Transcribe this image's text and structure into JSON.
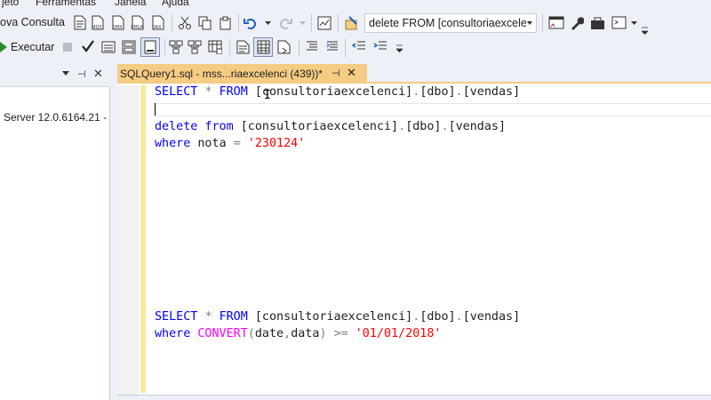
{
  "menu": {
    "items": [
      "jeto",
      "Ferramentas",
      "Janela",
      "Ajuda"
    ]
  },
  "toolbar": {
    "new_query_label": "ova Consulta",
    "execute_label": "Executar",
    "query_combo_value": "delete FROM [consultoriaexcele"
  },
  "explorer": {
    "server_node": "Server 12.0.6164.21 -"
  },
  "tab": {
    "title": "SQLQuery1.sql - mss...riaexcelenci (439))*",
    "pin_glyph": "⊣",
    "close_glyph": "✕"
  },
  "editor": {
    "lines": [
      {
        "tokens": [
          [
            "kw",
            "SELECT"
          ],
          [
            "plain",
            " "
          ],
          [
            "op",
            "*"
          ],
          [
            "plain",
            " "
          ],
          [
            "kw",
            "FROM"
          ],
          [
            "plain",
            " [consultoriaexcelenci]"
          ],
          [
            "op",
            "."
          ],
          [
            "plain",
            "[dbo]"
          ],
          [
            "op",
            "."
          ],
          [
            "plain",
            "[vendas]"
          ]
        ]
      },
      {
        "tokens": []
      },
      {
        "tokens": [
          [
            "kw",
            "delete"
          ],
          [
            "plain",
            " "
          ],
          [
            "kw",
            "from"
          ],
          [
            "plain",
            " [consultoriaexcelenci]"
          ],
          [
            "op",
            "."
          ],
          [
            "plain",
            "[dbo]"
          ],
          [
            "op",
            "."
          ],
          [
            "plain",
            "[vendas]"
          ]
        ]
      },
      {
        "tokens": [
          [
            "kw",
            "where"
          ],
          [
            "plain",
            " nota "
          ],
          [
            "op",
            "="
          ],
          [
            "plain",
            " "
          ],
          [
            "str",
            "'230124'"
          ]
        ]
      },
      {
        "tokens": [
          [
            "kw",
            "SELECT"
          ],
          [
            "plain",
            " "
          ],
          [
            "op",
            "*"
          ],
          [
            "plain",
            " "
          ],
          [
            "kw",
            "FROM"
          ],
          [
            "plain",
            " [consultoriaexcelenci]"
          ],
          [
            "op",
            "."
          ],
          [
            "plain",
            "[dbo]"
          ],
          [
            "op",
            "."
          ],
          [
            "plain",
            "[vendas]"
          ]
        ]
      },
      {
        "tokens": [
          [
            "kw",
            "where"
          ],
          [
            "plain",
            " "
          ],
          [
            "fn",
            "CONVERT"
          ],
          [
            "op",
            "("
          ],
          [
            "plain",
            "date"
          ],
          [
            "op",
            ","
          ],
          [
            "plain",
            "data"
          ],
          [
            "op",
            ")"
          ],
          [
            "plain",
            " "
          ],
          [
            "op",
            "&gt;="
          ],
          [
            "plain",
            " "
          ],
          [
            "str",
            "'01/01/2018'"
          ]
        ]
      }
    ]
  },
  "colors": {
    "keyword": "#0000ff",
    "operator": "#808080",
    "string": "#ff0000",
    "function": "#ff00ff",
    "tab_active": "#f5cc84",
    "chrome": "#eef0f7"
  }
}
